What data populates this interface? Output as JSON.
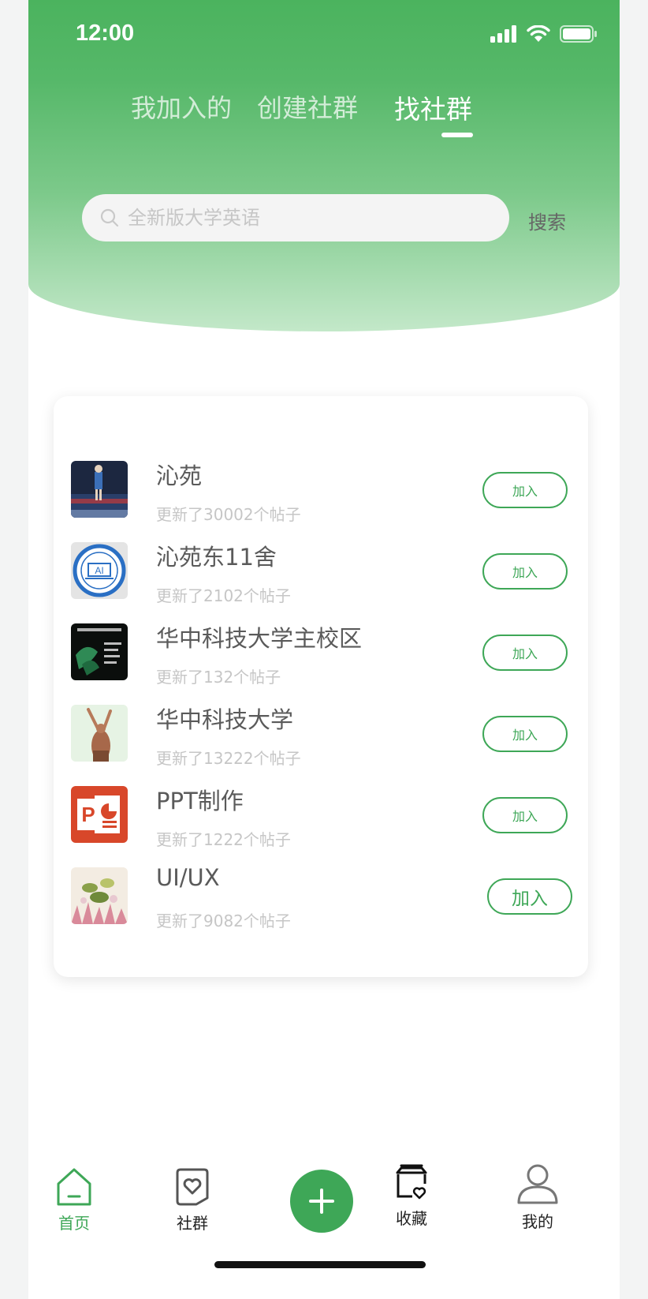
{
  "status_bar": {
    "time": "12:00"
  },
  "tabs": [
    {
      "label": "我加入的",
      "active": false
    },
    {
      "label": "创建社群",
      "active": false
    },
    {
      "label": "找社群",
      "active": true
    }
  ],
  "search": {
    "placeholder": "全新版大学英语",
    "button_label": "搜索"
  },
  "communities": [
    {
      "name": "沁苑",
      "subtitle": "更新了30002个帖子",
      "action": "加入"
    },
    {
      "name": "沁苑东11舍",
      "subtitle": "更新了2102个帖子",
      "action": "加入"
    },
    {
      "name": "华中科技大学主校区",
      "subtitle": "更新了132个帖子",
      "action": "加入"
    },
    {
      "name": "华中科技大学",
      "subtitle": "更新了13222个帖子",
      "action": "加入"
    },
    {
      "name": "PPT制作",
      "subtitle": "更新了1222个帖子",
      "action": "加入"
    },
    {
      "name": "UI/UX",
      "subtitle": "更新了9082个帖子",
      "action": "加入"
    }
  ],
  "bottom_nav": {
    "home": "首页",
    "community": "社群",
    "favorites": "收藏",
    "profile": "我的"
  },
  "colors": {
    "accent": "#3ea757",
    "header_top": "#4bb35e",
    "header_bottom": "#c3e8c9"
  }
}
